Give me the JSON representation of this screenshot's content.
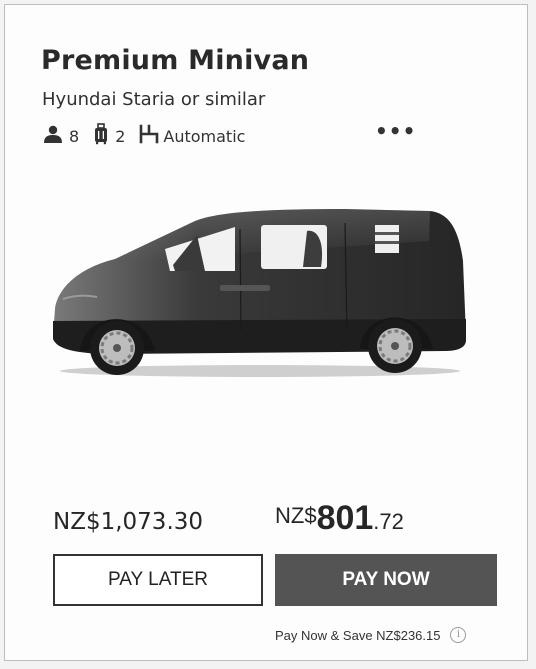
{
  "vehicle": {
    "category": "Premium Minivan",
    "model": "Hyundai Staria or similar",
    "passengers": "8",
    "bags": "2",
    "transmission": "Automatic",
    "more_label": "•••"
  },
  "pricing": {
    "pay_later_price": "NZ$1,073.30",
    "pay_now_currency": "NZ$",
    "pay_now_integer": "801",
    "pay_now_decimal": ".72",
    "pay_later_button": "PAY LATER",
    "pay_now_button": "PAY NOW",
    "savings_note": "Pay Now & Save NZ$236.15",
    "info_icon_label": "i"
  },
  "icons": {
    "passengers": "person-icon",
    "bags": "luggage-icon",
    "transmission": "gearshift-icon",
    "more": "more-options-icon",
    "info": "info-icon"
  }
}
